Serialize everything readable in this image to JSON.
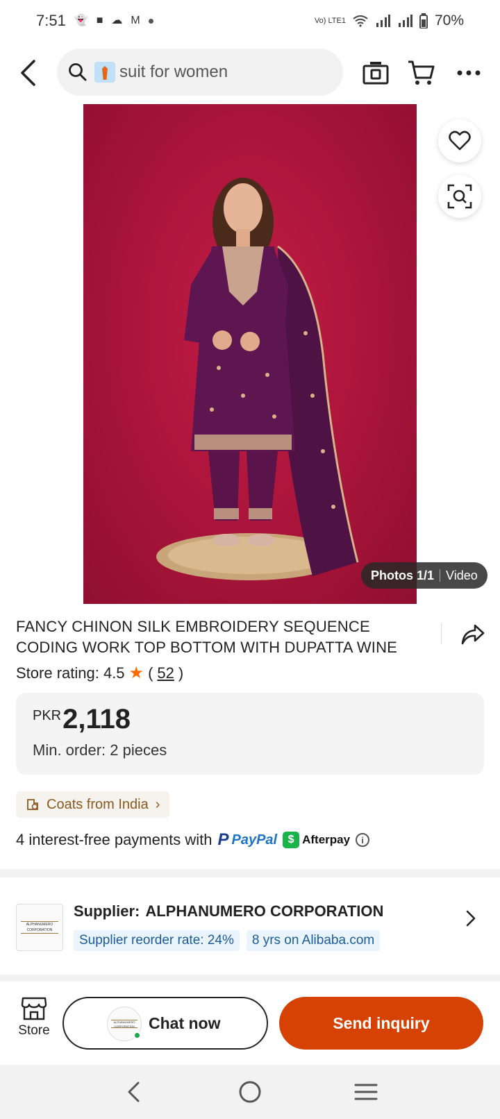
{
  "status_bar": {
    "time": "7:51",
    "battery": "70%",
    "network_label": "Vo) LTE1"
  },
  "search": {
    "query": "suit for women",
    "icons": [
      "search-icon",
      "tie-emoji-icon"
    ]
  },
  "header_icons": [
    "back-icon",
    "camera-search-icon",
    "cart-icon",
    "more-icon"
  ],
  "media": {
    "photos_label": "Photos 1/1",
    "video_label": "Video"
  },
  "product": {
    "title": "FANCY CHINON SILK EMBROIDERY SEQUENCE CODING WORK TOP BOTTOM WITH DUPATTA WINE",
    "store_rating_label": "Store rating: 4.5",
    "rating_count": "52",
    "currency": "PKR",
    "price": "2,118",
    "min_order": "Min. order: 2 pieces",
    "origin": "Coats from India"
  },
  "payments": {
    "text": "4 interest-free payments with",
    "paypal": "PayPal",
    "afterpay": "Afterpay"
  },
  "supplier": {
    "label": "Supplier:",
    "name": "ALPHANUMERO CORPORATION",
    "reorder_rate": "Supplier reorder rate: 24%",
    "years": "8 yrs on Alibaba.com",
    "logo_text": "ALPHANUMERO CORPORATION"
  },
  "actions": {
    "store": "Store",
    "chat": "Chat now",
    "inquiry": "Send inquiry"
  },
  "colors": {
    "accent": "#d64203",
    "image_background": "#a8143a",
    "dress": "#5e1650"
  }
}
